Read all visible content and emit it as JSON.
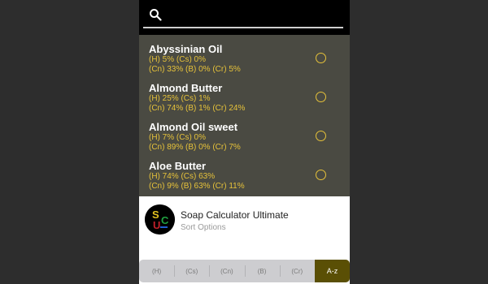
{
  "search": {
    "icon": "search-icon"
  },
  "oils": [
    {
      "name": "Abyssinian Oil",
      "line1": "(H) 5% (Cs) 0%",
      "line2": "(Cn) 33% (B) 0% (Cr) 5%",
      "selected": false
    },
    {
      "name": "Almond Butter",
      "line1": "(H) 25% (Cs) 1%",
      "line2": "(Cn) 74% (B) 1% (Cr) 24%",
      "selected": false
    },
    {
      "name": "Almond Oil sweet",
      "line1": "(H) 7% (Cs) 0%",
      "line2": "(Cn) 89% (B) 0% (Cr) 7%",
      "selected": false
    },
    {
      "name": "Aloe Butter",
      "line1": "(H) 74% (Cs) 63%",
      "line2": "(Cn) 9% (B) 63% (Cr) 11%",
      "selected": false
    }
  ],
  "sheet": {
    "app_title": "Soap Calculator Ultimate",
    "subtitle": "Sort Options",
    "logo_letters": [
      "S",
      "U",
      "C"
    ]
  },
  "sort_options": [
    {
      "label": "(H)",
      "active": false
    },
    {
      "label": "(Cs)",
      "active": false
    },
    {
      "label": "(Cn)",
      "active": false
    },
    {
      "label": "(B)",
      "active": false
    },
    {
      "label": "(Cr)",
      "active": false
    },
    {
      "label": "A-z",
      "active": true
    }
  ],
  "colors": {
    "list_bg": "#4a4a42",
    "accent_yellow": "#e6c23a",
    "active_sort_bg": "#5a4f05",
    "search_bg": "#000000"
  }
}
